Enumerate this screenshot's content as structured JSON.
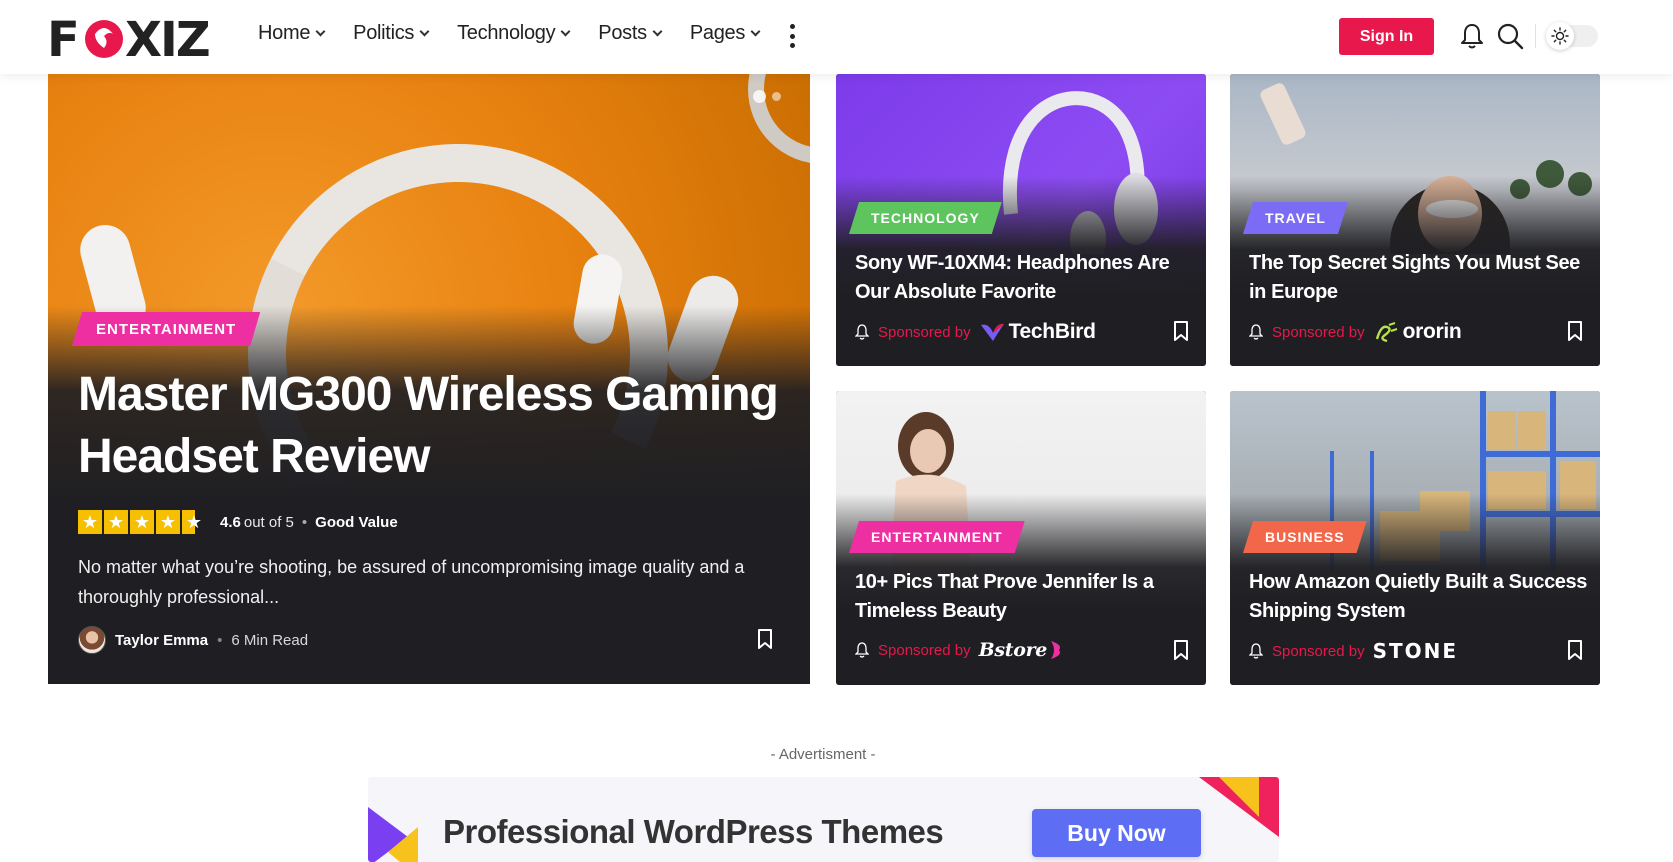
{
  "header": {
    "logo": "FOXIZ",
    "nav": [
      {
        "label": "Home"
      },
      {
        "label": "Politics"
      },
      {
        "label": "Technology"
      },
      {
        "label": "Posts"
      },
      {
        "label": "Pages"
      }
    ],
    "signin_label": "Sign In"
  },
  "hero": {
    "category": "ENTERTAINMENT",
    "title": "Master MG300 Wireless Gaming Headset Review",
    "rating_score": "4.6",
    "rating_outof": "out of 5",
    "rating_value": "Good Value",
    "rating_fraction": 0.92,
    "excerpt": "No matter what you’re shooting, be assured of uncompromising image quality and a thoroughly professional...",
    "author": "Taylor Emma",
    "read_time": "6 Min Read"
  },
  "cards": [
    {
      "category": "TECHNOLOGY",
      "category_color": "#5ec45e",
      "title": "Sony WF-10XM4: Headphones Are Our Absolute Favorite",
      "sponsor_label": "Sponsored by",
      "brand": "TechBird"
    },
    {
      "category": "TRAVEL",
      "category_color": "#7b6cf6",
      "title": "The Top Secret Sights You Must See in Europe",
      "sponsor_label": "Sponsored by",
      "brand": "ororin"
    },
    {
      "category": "ENTERTAINMENT",
      "category_color": "#ee2fa2",
      "title": "10+ Pics That Prove Jennifer Is a Timeless Beauty",
      "sponsor_label": "Sponsored by",
      "brand": "Bstore"
    },
    {
      "category": "BUSINESS",
      "category_color": "#f2674a",
      "title": "How Amazon Quietly Built a Success Shipping System",
      "sponsor_label": "Sponsored by",
      "brand": "STONE"
    }
  ],
  "advert": {
    "label": "- Advertisment -",
    "headline": "Professional WordPress Themes",
    "button": "Buy Now"
  },
  "colors": {
    "accent": "#e8174c",
    "card_bg": "#1f1f23"
  }
}
